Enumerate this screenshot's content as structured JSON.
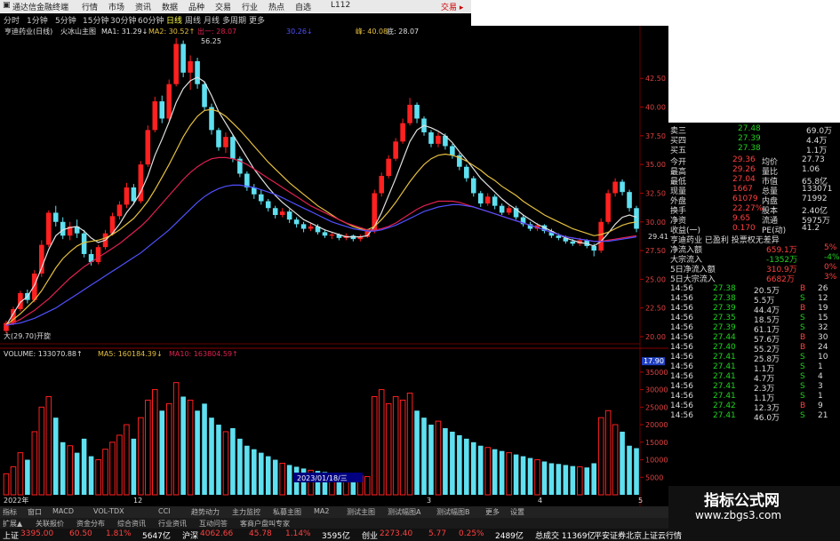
{
  "titlebar": {
    "app_name": "通达信金融终端",
    "menus": [
      "行情",
      "市场",
      "资讯",
      "数据",
      "品种",
      "交易",
      "行业",
      "热点",
      "自选"
    ],
    "account": "L112",
    "trade": "交易 ▸"
  },
  "periodbar": {
    "periods": [
      "分时",
      "1分钟",
      "5分钟",
      "15分钟",
      "30分钟",
      "60分钟",
      "日线",
      "周线",
      "月线",
      "多周期",
      "更多"
    ],
    "active": "日线"
  },
  "main_header": {
    "stock": "亨迪药业(日线)",
    "indicator": "火冰山主图",
    "ma1": "MA1: 31.29↓",
    "ma2": "MA2: 30.52↑",
    "ma3": "出一: 28.07",
    "ma4": "30.26↓",
    "ma5": "峰: 40.08",
    "ma6": "底: 28.07"
  },
  "colors": {
    "background": "#000000",
    "up": "#ff2020",
    "down": "#5fe0f0",
    "ma_white": "#e0e0e0",
    "ma_yellow": "#e6c040",
    "ma_red": "#e02050",
    "ma_blue": "#5050ff"
  },
  "price_axis": {
    "ticks": [
      "42.50",
      "40.00",
      "37.50",
      "35.00",
      "32.50",
      "30.00",
      "27.50",
      "25.00",
      "22.50",
      "20.00"
    ],
    "current": "17.90"
  },
  "chart_labels": {
    "high_mark": "56.25",
    "low_mark": "大(29.70)开旋",
    "last_price_label": "29.41",
    "date_label": "2023/01/18/三",
    "axis_years": [
      "2022年",
      "12",
      "3",
      "4",
      "5"
    ]
  },
  "volume_header": {
    "volume": "VOLUME: 133070.88↑",
    "ma5": "MA5: 160184.39↓",
    "ma10": "MA10: 163804.59↑"
  },
  "volume_axis": {
    "ticks": [
      "35000",
      "30000",
      "25000",
      "20000",
      "15000",
      "10000",
      "5000"
    ]
  },
  "bottomtabs": [
    "指标",
    "窗口",
    "MACD",
    "VOL-TDX",
    "CCI",
    "趋势动力",
    "主力监控",
    "私募主图",
    "MA2",
    "测试主图",
    "测试幅图A",
    "测试幅图B",
    "更多",
    "设置"
  ],
  "bottomtabs2": [
    "扩展▲",
    "关联报价",
    "资金分布",
    "综合资讯",
    "行业资讯",
    "互动问答",
    "客商户盘叫专家"
  ],
  "right_panel": {
    "quotes": [
      {
        "label": "卖三",
        "price": "27.48",
        "vol": "69.0万"
      },
      {
        "label": "买四",
        "price": "27.39",
        "vol": "4.4万"
      },
      {
        "label": "买五",
        "price": "27.38",
        "vol": "1.1万"
      }
    ],
    "stats": [
      {
        "l1": "今开",
        "v1": "29.36",
        "l2": "均价",
        "v2": "27.73"
      },
      {
        "l1": "最高",
        "v1": "29.26",
        "l2": "量比",
        "v2": "1.06"
      },
      {
        "l1": "最低",
        "v1": "27.04",
        "l2": "市值",
        "v2": "65.8亿"
      },
      {
        "l1": "现量",
        "v1": "1667",
        "l2": "总量",
        "v2": "133071"
      },
      {
        "l1": "外盘",
        "v1": "61079",
        "l2": "内盘",
        "v2": "71992"
      },
      {
        "l1": "换手",
        "v1": "22.27%",
        "l2": "股本",
        "v2": "2.40亿"
      },
      {
        "l1": "净资",
        "v1": "9.65",
        "l2": "流通",
        "v2": "5975万"
      },
      {
        "l1": "收益(一)",
        "v1": "0.170",
        "l2": "PE(动)",
        "v2": "41.2"
      }
    ],
    "profile": "亨迪药业 已盈利 投票权无差异",
    "flows": [
      {
        "label": "净流入额",
        "value": "659.1万",
        "pct": "5%"
      },
      {
        "label": "大宗流入",
        "value": "-1352万",
        "pct": "-4%"
      },
      {
        "label": "5日净流入额",
        "value": "310.9万",
        "pct": "0%"
      },
      {
        "label": "5日大宗流入",
        "value": "6682万",
        "pct": "3%"
      }
    ],
    "ticks": [
      {
        "t": "14:56",
        "p": "27.38",
        "v": "20.5万",
        "s": "B",
        "n": "26"
      },
      {
        "t": "14:56",
        "p": "27.38",
        "v": "5.5万",
        "s": "S",
        "n": "12"
      },
      {
        "t": "14:56",
        "p": "27.39",
        "v": "44.4万",
        "s": "B",
        "n": "19"
      },
      {
        "t": "14:56",
        "p": "27.35",
        "v": "18.5万",
        "s": "S",
        "n": "15"
      },
      {
        "t": "14:56",
        "p": "27.39",
        "v": "61.1万",
        "s": "S",
        "n": "32"
      },
      {
        "t": "14:56",
        "p": "27.44",
        "v": "57.6万",
        "s": "B",
        "n": "30"
      },
      {
        "t": "14:56",
        "p": "27.40",
        "v": "55.2万",
        "s": "B",
        "n": "24"
      },
      {
        "t": "14:56",
        "p": "27.41",
        "v": "25.8万",
        "s": "S",
        "n": "10"
      },
      {
        "t": "14:56",
        "p": "27.41",
        "v": "1.1万",
        "s": "S",
        "n": "1"
      },
      {
        "t": "14:56",
        "p": "27.41",
        "v": "4.7万",
        "s": "S",
        "n": "4"
      },
      {
        "t": "14:56",
        "p": "27.41",
        "v": "2.3万",
        "s": "S",
        "n": "3"
      },
      {
        "t": "14:56",
        "p": "27.41",
        "v": "1.1万",
        "s": "S",
        "n": "1"
      },
      {
        "t": "14:56",
        "p": "27.42",
        "v": "12.3万",
        "s": "B",
        "n": "9"
      },
      {
        "t": "14:56",
        "p": "27.41",
        "v": "46.0万",
        "s": "S",
        "n": "21"
      }
    ]
  },
  "watermark": {
    "title": "指标公式网",
    "url": "www.zbgs3.com"
  },
  "statusbar": {
    "items": [
      {
        "label": "上证",
        "price": "3395.00",
        "chg": "60.50",
        "pct": "1.81%",
        "amt": "5647亿"
      },
      {
        "label": "沪深",
        "price": "4062.66",
        "chg": "45.78",
        "pct": "1.14%",
        "amt": "3595亿"
      },
      {
        "label": "创业",
        "price": "2273.40",
        "chg": "5.77",
        "pct": "0.25%",
        "amt": "2489亿"
      }
    ],
    "total": "总成交 11369亿",
    "note": "平安证券北京上证云行情"
  },
  "chart_data": [
    {
      "type": "candlestick",
      "title": "亨迪药业(日线)",
      "y_range": [
        20,
        46
      ],
      "candles": [
        [
          20.5,
          21.2,
          20.3,
          21.4
        ],
        [
          21.2,
          22.4,
          21.0,
          22.6
        ],
        [
          22.4,
          23.8,
          22.2,
          24.0
        ],
        [
          23.8,
          23.2,
          22.9,
          24.1
        ],
        [
          23.2,
          25.5,
          23.0,
          25.8
        ],
        [
          25.5,
          28.0,
          25.2,
          28.4
        ],
        [
          28.0,
          30.8,
          27.8,
          31.0
        ],
        [
          30.8,
          30.0,
          29.6,
          31.4
        ],
        [
          30.0,
          28.8,
          28.5,
          30.4
        ],
        [
          28.8,
          29.6,
          28.4,
          30.0
        ],
        [
          29.6,
          29.0,
          28.6,
          30.2
        ],
        [
          29.0,
          27.2,
          26.9,
          29.3
        ],
        [
          27.2,
          26.5,
          26.2,
          27.6
        ],
        [
          26.5,
          27.8,
          26.3,
          28.0
        ],
        [
          27.8,
          29.0,
          27.6,
          29.3
        ],
        [
          29.0,
          30.5,
          28.8,
          30.8
        ],
        [
          30.5,
          31.5,
          30.2,
          31.8
        ],
        [
          31.5,
          33.0,
          31.2,
          33.4
        ],
        [
          33.0,
          31.8,
          31.5,
          33.3
        ],
        [
          31.8,
          35.0,
          31.6,
          35.3
        ],
        [
          35.0,
          38.0,
          34.8,
          38.4
        ],
        [
          38.0,
          40.5,
          37.8,
          40.9
        ],
        [
          40.5,
          39.0,
          38.6,
          41.0
        ],
        [
          39.0,
          42.0,
          38.8,
          42.4
        ],
        [
          42.0,
          45.5,
          41.8,
          46.0
        ],
        [
          45.5,
          43.0,
          42.6,
          45.8
        ],
        [
          43.0,
          44.0,
          41.5,
          44.5
        ],
        [
          44.0,
          42.0,
          41.6,
          44.3
        ],
        [
          42.0,
          40.0,
          39.7,
          42.2
        ],
        [
          40.0,
          38.0,
          37.6,
          40.3
        ],
        [
          38.0,
          36.5,
          36.2,
          38.2
        ],
        [
          36.5,
          37.4,
          36.0,
          37.8
        ],
        [
          37.4,
          35.5,
          35.2,
          37.6
        ],
        [
          35.5,
          34.2,
          33.9,
          35.7
        ],
        [
          34.2,
          33.0,
          32.7,
          34.4
        ],
        [
          33.0,
          32.4,
          32.0,
          33.3
        ],
        [
          32.4,
          31.8,
          31.5,
          32.8
        ],
        [
          31.8,
          31.2,
          30.9,
          32.0
        ],
        [
          31.2,
          30.6,
          30.3,
          31.4
        ],
        [
          30.6,
          30.9,
          30.4,
          31.2
        ],
        [
          30.9,
          30.2,
          29.9,
          31.1
        ],
        [
          30.2,
          29.8,
          29.5,
          30.4
        ],
        [
          29.8,
          29.4,
          29.1,
          30.0
        ],
        [
          29.4,
          29.6,
          29.2,
          29.9
        ],
        [
          29.6,
          29.1,
          28.9,
          29.8
        ],
        [
          29.1,
          28.8,
          28.6,
          29.3
        ],
        [
          28.8,
          28.9,
          28.5,
          29.1
        ],
        [
          28.9,
          28.6,
          28.4,
          29.0
        ],
        [
          28.6,
          28.8,
          28.4,
          29.0
        ],
        [
          28.8,
          28.5,
          28.3,
          28.9
        ],
        [
          28.5,
          28.7,
          28.3,
          28.9
        ],
        [
          28.7,
          29.2,
          28.6,
          29.4
        ],
        [
          29.2,
          32.5,
          29.0,
          32.8
        ],
        [
          32.5,
          34.0,
          32.2,
          34.3
        ],
        [
          34.0,
          35.5,
          33.8,
          35.8
        ],
        [
          35.5,
          37.0,
          35.3,
          37.3
        ],
        [
          37.0,
          38.6,
          36.8,
          39.0
        ],
        [
          38.6,
          40.2,
          38.4,
          40.8
        ],
        [
          40.2,
          39.0,
          38.6,
          40.4
        ],
        [
          39.0,
          37.8,
          37.5,
          39.2
        ],
        [
          37.8,
          36.8,
          36.5,
          38.0
        ],
        [
          36.8,
          37.5,
          36.5,
          37.8
        ],
        [
          37.5,
          36.6,
          36.3,
          37.7
        ],
        [
          36.6,
          35.8,
          35.5,
          36.8
        ],
        [
          35.8,
          34.8,
          34.5,
          36.0
        ],
        [
          34.8,
          33.8,
          33.5,
          35.0
        ],
        [
          33.8,
          32.5,
          32.2,
          34.0
        ],
        [
          32.5,
          31.6,
          31.3,
          32.7
        ],
        [
          31.6,
          32.2,
          31.4,
          32.5
        ],
        [
          32.2,
          31.4,
          31.1,
          32.4
        ],
        [
          31.4,
          30.8,
          30.6,
          31.6
        ],
        [
          30.8,
          31.2,
          30.6,
          31.4
        ],
        [
          31.2,
          30.4,
          30.2,
          31.4
        ],
        [
          30.4,
          29.8,
          29.6,
          30.6
        ],
        [
          29.8,
          29.4,
          29.2,
          30.0
        ],
        [
          29.4,
          29.7,
          29.2,
          29.9
        ],
        [
          29.7,
          29.2,
          29.0,
          29.8
        ],
        [
          29.2,
          28.8,
          28.6,
          29.4
        ],
        [
          28.8,
          28.6,
          28.4,
          29.0
        ],
        [
          28.6,
          28.3,
          28.1,
          28.8
        ],
        [
          28.3,
          28.1,
          27.9,
          28.5
        ],
        [
          28.1,
          28.4,
          27.9,
          28.6
        ],
        [
          28.4,
          27.9,
          27.7,
          28.5
        ],
        [
          27.9,
          27.5,
          27.0,
          28.1
        ],
        [
          27.5,
          30.0,
          27.3,
          30.3
        ],
        [
          30.0,
          32.5,
          29.8,
          32.8
        ],
        [
          32.5,
          33.5,
          32.2,
          33.8
        ],
        [
          33.5,
          32.6,
          32.3,
          33.7
        ],
        [
          32.6,
          31.2,
          30.9,
          32.8
        ],
        [
          31.2,
          29.4,
          29.1,
          31.4
        ]
      ],
      "ma_short": [
        21,
        22,
        23,
        23.5,
        24.5,
        26,
        27.6,
        28.8,
        29.3,
        29.5,
        29.6,
        29.2,
        28.6,
        28.2,
        28.4,
        29,
        29.8,
        30.8,
        31.6,
        32.6,
        34,
        35.8,
        37.2,
        38.7,
        40.4,
        41.6,
        42.3,
        42.6,
        42.2,
        41,
        39.6,
        38.6,
        37.6,
        36.6,
        35.6,
        34.6,
        33.8,
        33,
        32.3,
        31.7,
        31.2,
        30.7,
        30.2,
        29.9,
        29.6,
        29.3,
        29.1,
        28.9,
        28.7,
        28.7,
        28.7,
        28.8,
        29.6,
        30.8,
        32.3,
        33.8,
        35.4,
        37,
        38,
        38.4,
        38.2,
        37.9,
        37.5,
        36.9,
        36.1,
        35.4,
        34.6,
        33.8,
        33.2,
        32.6,
        32,
        31.5,
        31.1,
        30.6,
        30.2,
        29.8,
        29.5,
        29.2,
        28.9,
        28.6,
        28.4,
        28.2,
        28.1,
        27.9,
        28.3,
        29,
        29.8,
        30.4,
        30.6,
        30.4
      ],
      "ma_mid": [
        21,
        21.5,
        22,
        22.6,
        23.2,
        24,
        25,
        26,
        26.8,
        27.4,
        27.9,
        28.2,
        28.3,
        28.4,
        28.6,
        28.9,
        29.3,
        29.8,
        30.3,
        31,
        31.8,
        32.8,
        33.9,
        35,
        36.2,
        37.4,
        38.4,
        39.2,
        39.7,
        39.8,
        39.6,
        39.2,
        38.6,
        38,
        37.3,
        36.6,
        35.9,
        35.2,
        34.6,
        34,
        33.4,
        32.9,
        32.4,
        31.9,
        31.4,
        31,
        30.6,
        30.2,
        29.9,
        29.6,
        29.4,
        29.3,
        29.6,
        30.2,
        30.9,
        31.7,
        32.6,
        33.5,
        34.3,
        35,
        35.5,
        35.8,
        35.9,
        35.8,
        35.6,
        35.3,
        34.9,
        34.5,
        34,
        33.6,
        33.1,
        32.7,
        32.3,
        31.8,
        31.4,
        31,
        30.6,
        30.3,
        30,
        29.7,
        29.4,
        29.2,
        29,
        28.8,
        28.9,
        29.1,
        29.4,
        29.7,
        29.9,
        30
      ],
      "ma_long": [
        21,
        21.2,
        21.5,
        21.9,
        22.3,
        22.8,
        23.3,
        23.9,
        24.5,
        25.1,
        25.6,
        26.1,
        26.5,
        26.9,
        27.3,
        27.7,
        28.1,
        28.6,
        29.1,
        29.6,
        30.2,
        30.9,
        31.6,
        32.3,
        33,
        33.7,
        34.3,
        34.8,
        35.2,
        35.5,
        35.6,
        35.6,
        35.5,
        35.3,
        35,
        34.6,
        34.2,
        33.8,
        33.4,
        33,
        32.6,
        32.2,
        31.8,
        31.4,
        31.1,
        30.8,
        30.5,
        30.2,
        29.9,
        29.7,
        29.5,
        29.3,
        29.3,
        29.4,
        29.6,
        29.9,
        30.3,
        30.7,
        31.1,
        31.4,
        31.6,
        31.8,
        31.8,
        31.8,
        31.7,
        31.5,
        31.3,
        31.1,
        30.9,
        30.7,
        30.5,
        30.3,
        30.1,
        29.9,
        29.7,
        29.5,
        29.3,
        29.1,
        28.9,
        28.7,
        28.6,
        28.5,
        28.4,
        28.3,
        28.3,
        28.4,
        28.5,
        28.6,
        28.7,
        28.8
      ],
      "ma_xlong": [
        21,
        21.1,
        21.2,
        21.4,
        21.6,
        21.9,
        22.2,
        22.5,
        22.9,
        23.3,
        23.7,
        24.1,
        24.5,
        24.9,
        25.3,
        25.7,
        26.1,
        26.5,
        26.9,
        27.3,
        27.8,
        28.3,
        28.8,
        29.3,
        29.9,
        30.5,
        31.1,
        31.7,
        32.2,
        32.6,
        32.9,
        33.1,
        33.2,
        33.2,
        33.1,
        33,
        32.8,
        32.6,
        32.4,
        32.1,
        31.8,
        31.5,
        31.2,
        30.9,
        30.6,
        30.3,
        30,
        29.8,
        29.6,
        29.4,
        29.3,
        29.2,
        29.2,
        29.3,
        29.5,
        29.7,
        30,
        30.3,
        30.6,
        30.9,
        31.1,
        31.3,
        31.4,
        31.5,
        31.5,
        31.4,
        31.3,
        31.1,
        30.9,
        30.7,
        30.5,
        30.3,
        30.1,
        29.9,
        29.7,
        29.5,
        29.3,
        29.1,
        28.9,
        28.7,
        28.6,
        28.5,
        28.4,
        28.3,
        28.3,
        28.3,
        28.4,
        28.5,
        28.6,
        28.7
      ]
    },
    {
      "type": "bar",
      "title": "VOLUME",
      "y_range": [
        0,
        38000
      ],
      "values": [
        6000,
        8000,
        12000,
        10000,
        18000,
        25000,
        28000,
        22000,
        15000,
        14000,
        12000,
        16000,
        11000,
        10000,
        13000,
        15000,
        17000,
        20000,
        16000,
        22000,
        27000,
        30000,
        24000,
        26000,
        32000,
        28000,
        27000,
        24000,
        26000,
        22000,
        20000,
        18000,
        19000,
        16000,
        14000,
        13000,
        12000,
        11000,
        10000,
        9000,
        8500,
        8000,
        7500,
        7000,
        6800,
        6500,
        6200,
        6000,
        5800,
        5600,
        5400,
        5200,
        28000,
        30000,
        26000,
        28000,
        27000,
        29000,
        24000,
        22000,
        20000,
        21000,
        19000,
        18000,
        17000,
        16000,
        15000,
        14000,
        13500,
        13000,
        12500,
        12000,
        11500,
        11000,
        10500,
        10000,
        9500,
        9000,
        8800,
        8500,
        8200,
        8000,
        7800,
        9000,
        22000,
        24000,
        20000,
        18000,
        14000,
        13300
      ]
    }
  ]
}
